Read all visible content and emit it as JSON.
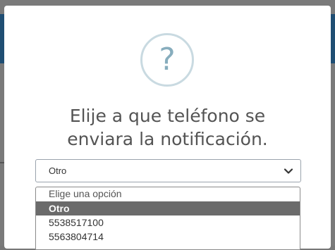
{
  "modal": {
    "icon": "question-icon",
    "icon_glyph": "?",
    "title_line1": "Elije a que teléfono se",
    "title_line2": "enviara la notificación."
  },
  "select": {
    "value": "Otro",
    "icon": "chevron-down-icon"
  },
  "dropdown": {
    "options": [
      {
        "label": "Elige una opción",
        "selected": false
      },
      {
        "label": "Otro",
        "selected": true
      },
      {
        "label": "5538517100",
        "selected": false
      },
      {
        "label": "5563804714",
        "selected": false
      }
    ]
  },
  "colors": {
    "overlay": "#7a7a7a",
    "modal_bg": "#ffffff",
    "icon_ring": "#c9dae1",
    "icon_glyph": "#87adbd",
    "title_text": "#545454",
    "selected_option_bg": "#6b6b6b"
  }
}
